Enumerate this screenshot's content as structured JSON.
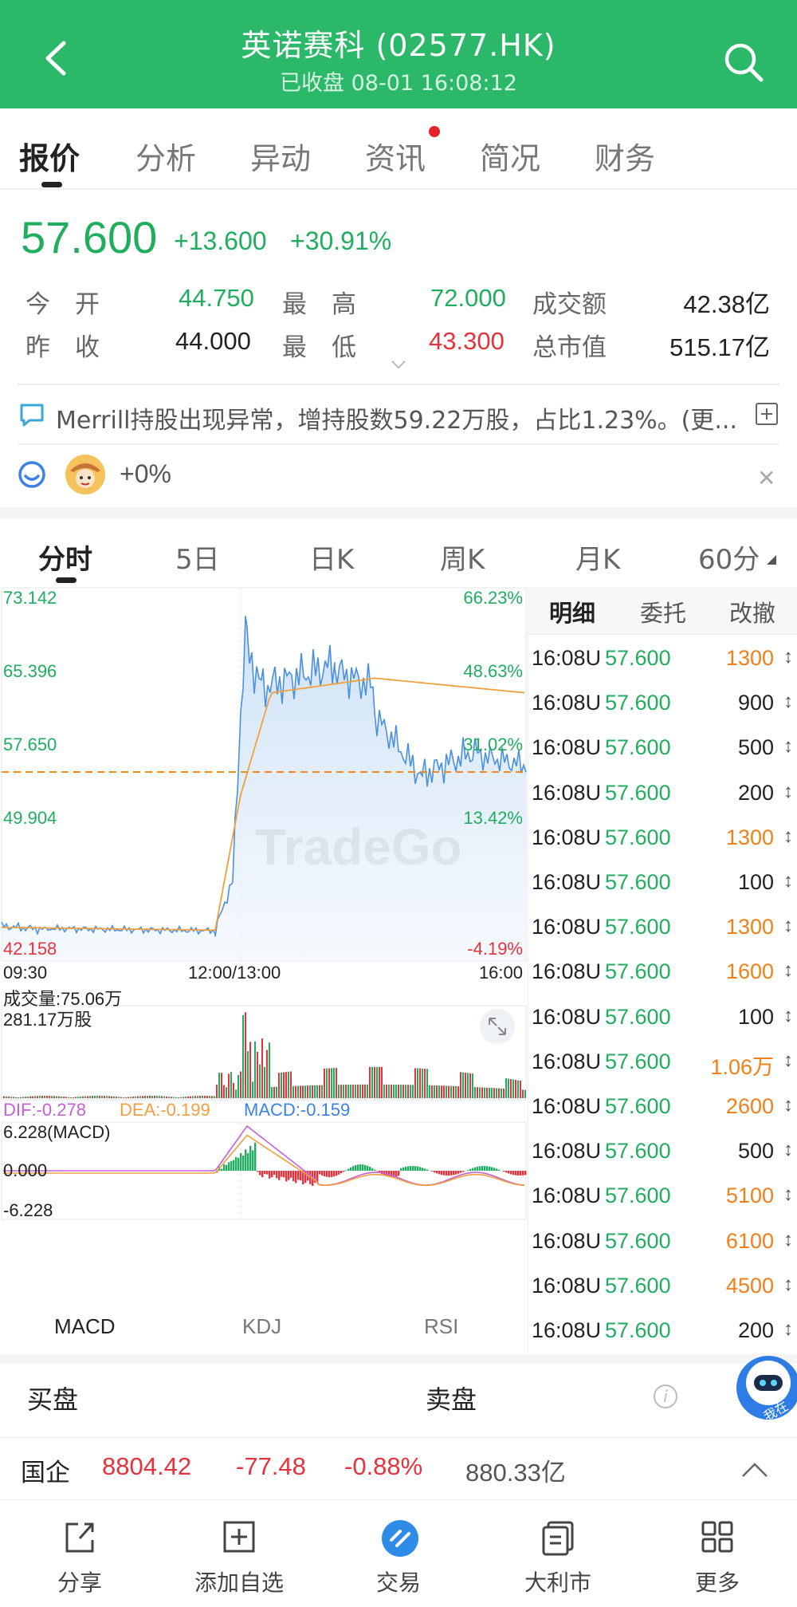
{
  "header": {
    "title": "英诺赛科 (02577.HK)",
    "subtitle": "已收盘 08-01 16:08:12"
  },
  "tabs": [
    "报价",
    "分析",
    "异动",
    "资讯",
    "简况",
    "财务"
  ],
  "quote": {
    "price": "57.600",
    "change": "+13.600",
    "change_pct": "+30.91%",
    "rows": [
      {
        "l1": "今　开",
        "v1": "44.750",
        "l2": "最　高",
        "v2": "72.000",
        "l3": "成交额",
        "v3": "42.38亿"
      },
      {
        "l1": "昨　收",
        "v1": "44.000",
        "l2": "最　低",
        "v2": "43.300",
        "l3": "总市值",
        "v3": "515.17亿"
      }
    ]
  },
  "news": {
    "text": "Merrill持股出现异常，增持股数59.22万股，占比1.23%。(更..."
  },
  "sentiment": {
    "value": "+0%"
  },
  "chart_tabs": [
    "分时",
    "5日",
    "日K",
    "周K",
    "月K",
    "60分"
  ],
  "chart_data": {
    "type": "line",
    "price_axis": [
      "73.142",
      "65.396",
      "57.650",
      "49.904",
      "42.158"
    ],
    "pct_axis": [
      "66.23%",
      "48.63%",
      "31.02%",
      "13.42%",
      "-4.19%"
    ],
    "time_axis": [
      "09:30",
      "12:00/13:00",
      "16:00"
    ],
    "volume_label": "成交量:75.06万",
    "volume_max": "281.17万股",
    "macd_label": {
      "dif": "DIF:-0.278",
      "dea": "DEA:-0.199",
      "macd": "MACD:-0.159"
    },
    "macd_axis": [
      "6.228(MACD)",
      "0.000",
      "-6.228"
    ],
    "watermark": "TradeGo",
    "colors": {
      "price": "#4a90e2",
      "avg": "#f0a040",
      "up": "#e5323c",
      "down": "#20ad5f"
    }
  },
  "detail": {
    "tabs": [
      "明细",
      "委托",
      "改撤"
    ],
    "rows": [
      {
        "t": "16:08U",
        "p": "57.600",
        "v": "1300",
        "c": "orange"
      },
      {
        "t": "16:08U",
        "p": "57.600",
        "v": "900",
        "c": "dark"
      },
      {
        "t": "16:08U",
        "p": "57.600",
        "v": "500",
        "c": "dark"
      },
      {
        "t": "16:08U",
        "p": "57.600",
        "v": "200",
        "c": "dark"
      },
      {
        "t": "16:08U",
        "p": "57.600",
        "v": "1300",
        "c": "orange"
      },
      {
        "t": "16:08U",
        "p": "57.600",
        "v": "100",
        "c": "dark"
      },
      {
        "t": "16:08U",
        "p": "57.600",
        "v": "1300",
        "c": "orange"
      },
      {
        "t": "16:08U",
        "p": "57.600",
        "v": "1600",
        "c": "orange"
      },
      {
        "t": "16:08U",
        "p": "57.600",
        "v": "100",
        "c": "dark"
      },
      {
        "t": "16:08U",
        "p": "57.600",
        "v": "1.06万",
        "c": "orange"
      },
      {
        "t": "16:08U",
        "p": "57.600",
        "v": "2600",
        "c": "orange"
      },
      {
        "t": "16:08U",
        "p": "57.600",
        "v": "500",
        "c": "dark"
      },
      {
        "t": "16:08U",
        "p": "57.600",
        "v": "5100",
        "c": "orange"
      },
      {
        "t": "16:08U",
        "p": "57.600",
        "v": "6100",
        "c": "orange"
      },
      {
        "t": "16:08U",
        "p": "57.600",
        "v": "4500",
        "c": "orange"
      },
      {
        "t": "16:08U",
        "p": "57.600",
        "v": "200",
        "c": "dark"
      }
    ]
  },
  "indicator_tabs": [
    "MACD",
    "KDJ",
    "RSI"
  ],
  "bidask": {
    "bid": "买盘",
    "ask": "卖盘"
  },
  "robot_text": "我在",
  "index_bar": {
    "name": "国企",
    "value": "8804.42",
    "change": "-77.48",
    "change_pct": "-0.88%",
    "turnover": "880.33亿"
  },
  "bottom_nav": [
    "分享",
    "添加自选",
    "交易",
    "大利市",
    "更多"
  ]
}
